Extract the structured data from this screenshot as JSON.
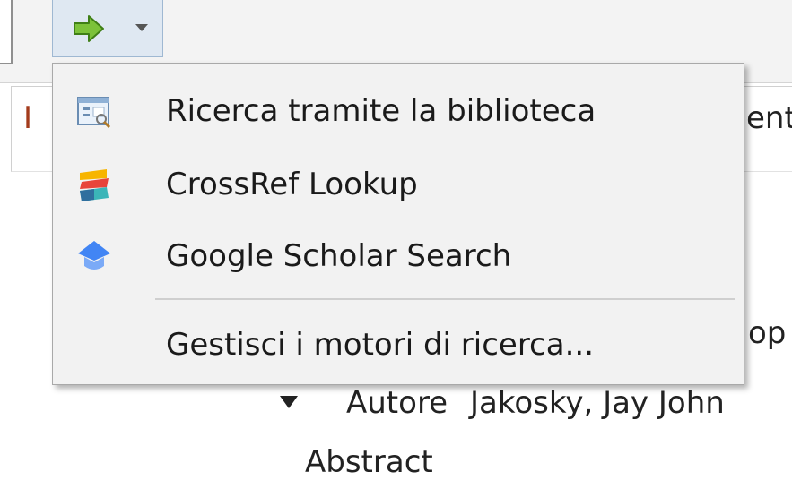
{
  "background": {
    "tab_left_partial": "I",
    "tab_right_partial": "ent",
    "title_field_tail": "op",
    "author": {
      "label": "Autore",
      "value": "Jakosky, Jay John"
    },
    "abstract_label": "Abstract"
  },
  "toolbar": {
    "lookup_button_icon": "green-arrow-right-icon",
    "dropdown_icon": "chevron-down-icon"
  },
  "menu": {
    "items": [
      {
        "label": "Ricerca tramite la biblioteca",
        "icon": "library-catalog-icon"
      },
      {
        "label": "CrossRef Lookup",
        "icon": "crossref-icon"
      },
      {
        "label": "Google Scholar Search",
        "icon": "google-scholar-icon"
      }
    ],
    "manage_label": "Gestisci i motori di ricerca..."
  },
  "colors": {
    "menu_background": "#f2f2f2",
    "toolbar_button_bg": "#dfe8f2",
    "arrow_green": "#7cc23a",
    "scholar_blue": "#4285f4",
    "crossref_yellow": "#f7b500",
    "crossref_red": "#e8443a",
    "crossref_teal": "#3bb5b8",
    "tab_red_text": "#a33b1c"
  }
}
